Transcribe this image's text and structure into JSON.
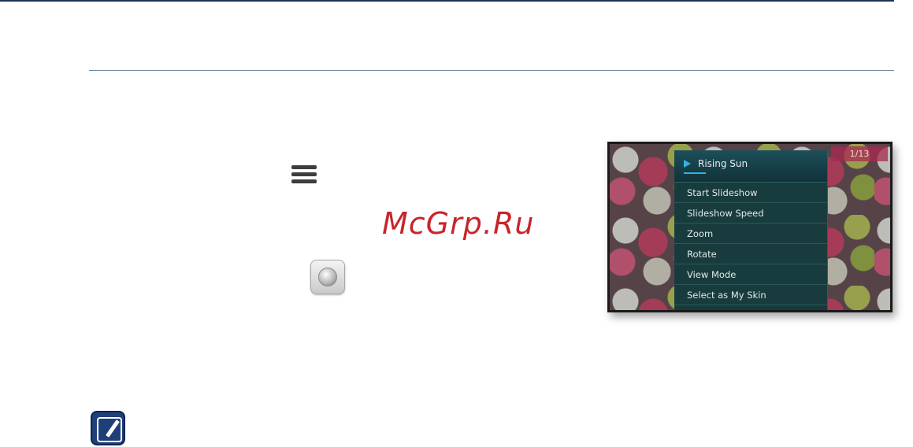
{
  "watermark": {
    "text": "McGrp.Ru"
  },
  "icons": {
    "menu_key": "menu-icon",
    "select_key": "select-button-icon",
    "note": "note-icon"
  },
  "device_screen": {
    "counter": "1/13",
    "menu": {
      "title": "Rising Sun",
      "items": [
        "Start Slideshow",
        "Slideshow Speed",
        "Zoom",
        "Rotate",
        "View Mode",
        "Select as My Skin"
      ]
    }
  },
  "colors": {
    "rule": "#1c3553",
    "accent": "#35b1e6",
    "watermark": "#c8252a",
    "note_icon": "#1f3f78"
  }
}
